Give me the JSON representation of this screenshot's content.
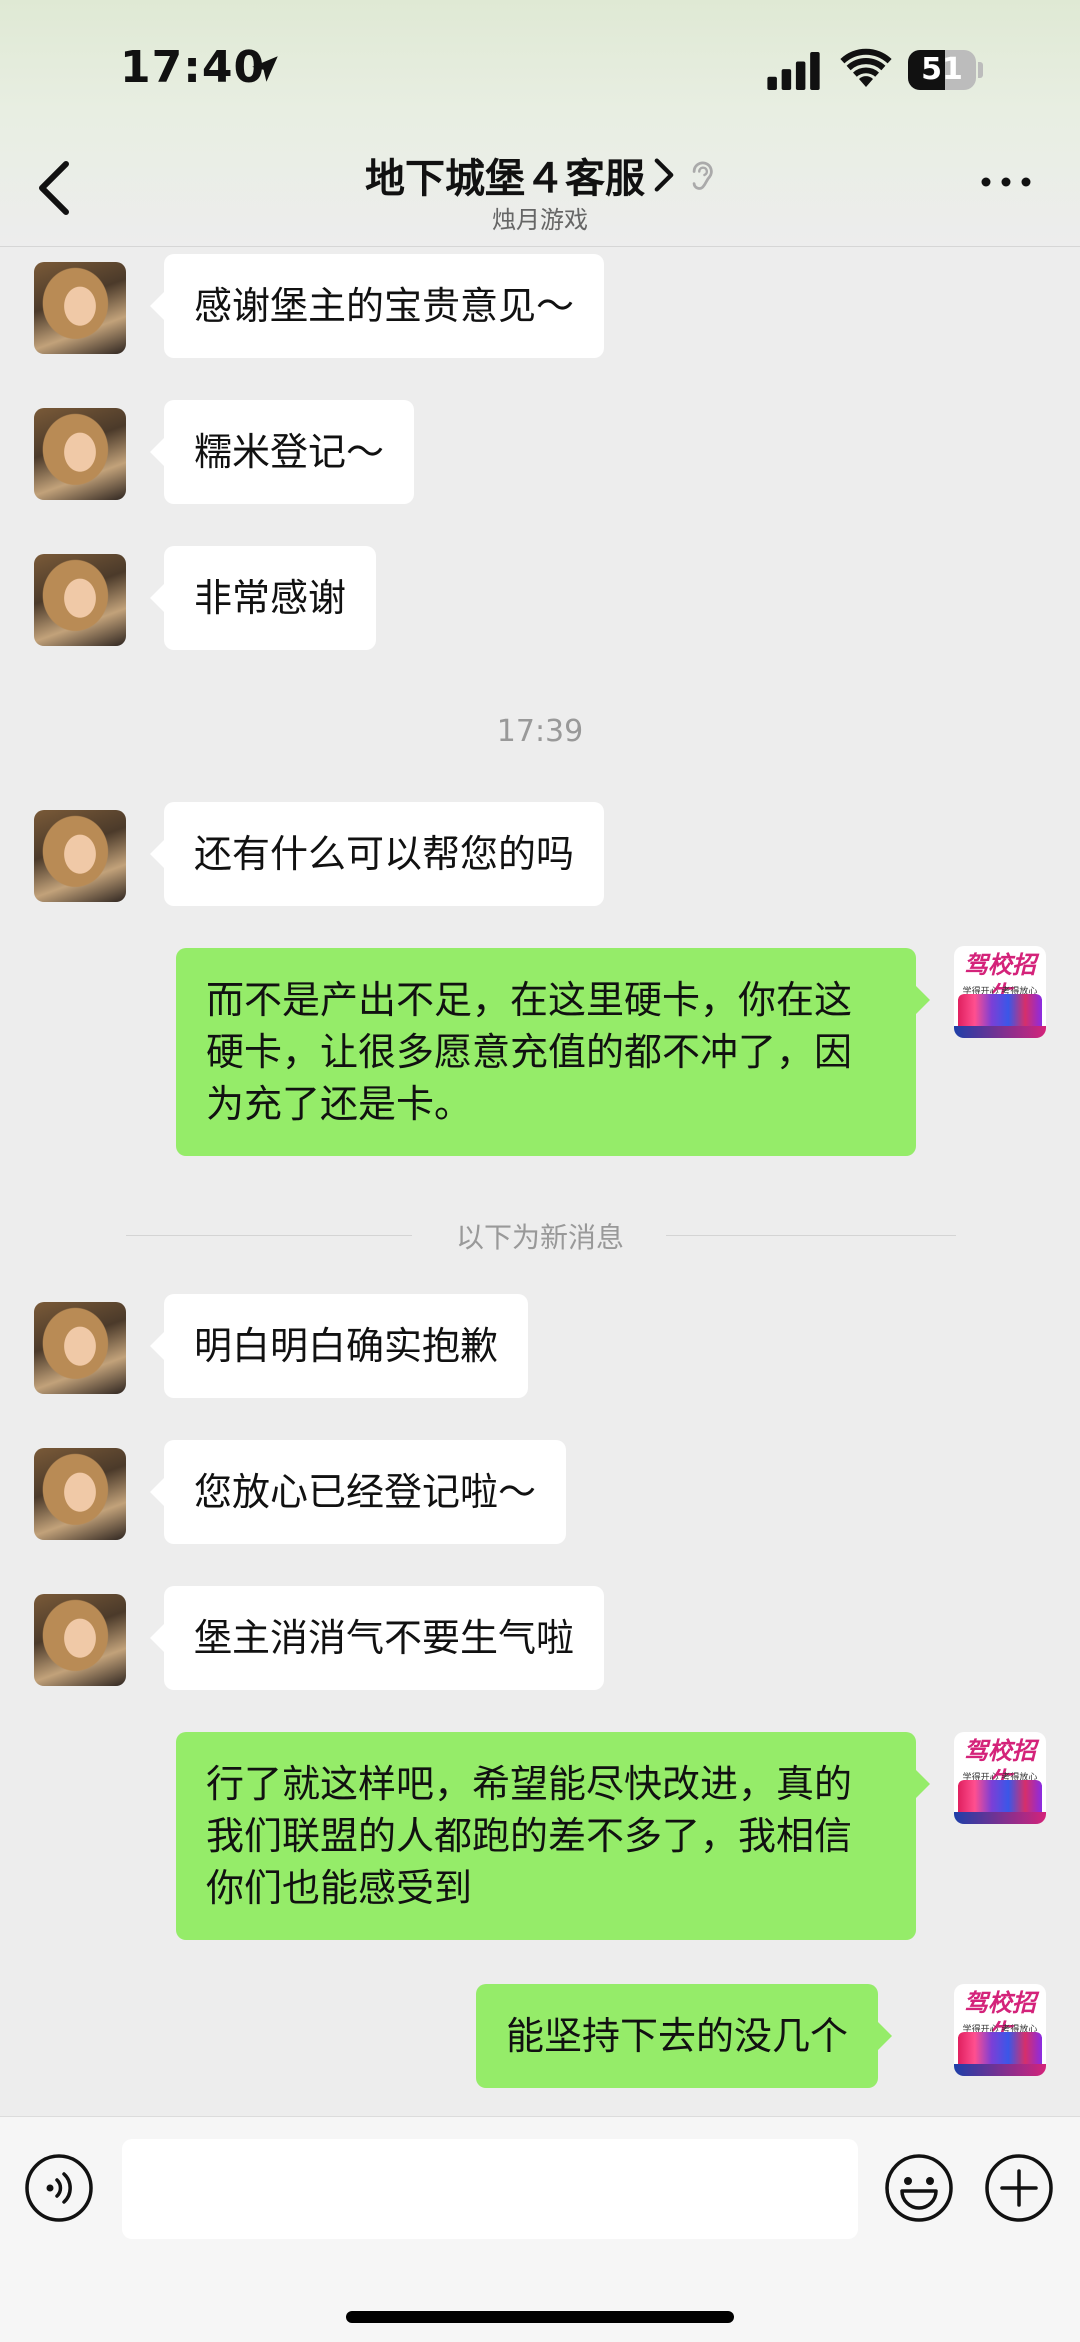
{
  "status_bar": {
    "time": "17:40",
    "battery": "51",
    "icons": [
      "location-arrow-icon",
      "signal-icon",
      "wifi-icon",
      "battery-icon"
    ]
  },
  "header": {
    "title": "地下城堡４客服",
    "subtitle": "烛月游戏",
    "icons": [
      "back-icon",
      "chevron-right-icon",
      "ear-icon",
      "more-icon"
    ]
  },
  "messages": [
    {
      "side": "in",
      "text": "感谢堡主的宝贵意见～"
    },
    {
      "side": "in",
      "text": "糯米登记～"
    },
    {
      "side": "in",
      "text": "非常感谢"
    },
    {
      "side": "in",
      "text": "还有什么可以帮您的吗"
    },
    {
      "side": "out",
      "text": "而不是产出不足，在这里硬卡，你在这硬卡，让很多愿意充值的都不冲了，因为充了还是卡。"
    },
    {
      "side": "in",
      "text": "明白明白确实抱歉"
    },
    {
      "side": "in",
      "text": "您放心已经登记啦～"
    },
    {
      "side": "in",
      "text": "堡主消消气不要生气啦"
    },
    {
      "side": "out",
      "text": "行了就这样吧，希望能尽快改进，真的我们联盟的人都跑的差不多了，我相信你们也能感受到"
    },
    {
      "side": "out",
      "text": "能坚持下去的没几个"
    }
  ],
  "timestamp": "17:39",
  "new_messages_divider": "以下为新消息",
  "self_avatar": {
    "title": "驾校招生",
    "subtitle": "学得开心 考得放心"
  },
  "input_bar": {
    "value": "",
    "icons": [
      "voice-icon",
      "emoji-icon",
      "plus-icon"
    ]
  }
}
